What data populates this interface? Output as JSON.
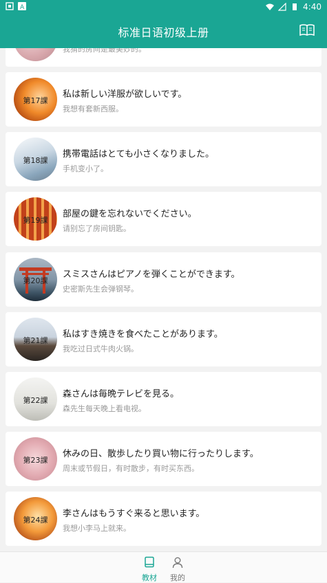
{
  "status_bar": {
    "time": "4:40"
  },
  "app_bar": {
    "title": "标准日语初级上册"
  },
  "lessons": [
    {
      "label": "",
      "jp": "",
      "cn": "我猜的房间是最美妙的。"
    },
    {
      "label": "第17課",
      "jp": "私は新しい洋服が欲しいです。",
      "cn": "我想有套新西服。"
    },
    {
      "label": "第18課",
      "jp": "携帯電話はとても小さくなりました。",
      "cn": "手机变小了。"
    },
    {
      "label": "第19課",
      "jp": "部屋の鍵を忘れないでください。",
      "cn": "请别忘了房间钥匙。"
    },
    {
      "label": "第20課",
      "jp": "スミスさんはピアノを弾くことができます。",
      "cn": "史密斯先生会弹钢琴。"
    },
    {
      "label": "第21課",
      "jp": "私はすき焼きを食べたことがあります。",
      "cn": "我吃过日式牛肉火锅。"
    },
    {
      "label": "第22課",
      "jp": "森さんは毎晩テレビを見る。",
      "cn": "森先生每天晚上看电视。"
    },
    {
      "label": "第23課",
      "jp": "休みの日、散歩したり買い物に行ったりします。",
      "cn": "周末或节假日，有时散步，有时买东西。"
    },
    {
      "label": "第24課",
      "jp": "李さんはもうすぐ来ると思います。",
      "cn": "我想小李马上就来。"
    }
  ],
  "bottom_nav": {
    "tab1": {
      "label": "教材",
      "icon": "book-icon",
      "color": "#1aa694"
    },
    "tab2": {
      "label": "我的",
      "icon": "person-icon",
      "color": "#777777"
    }
  },
  "colors": {
    "primary": "#1aa694"
  }
}
